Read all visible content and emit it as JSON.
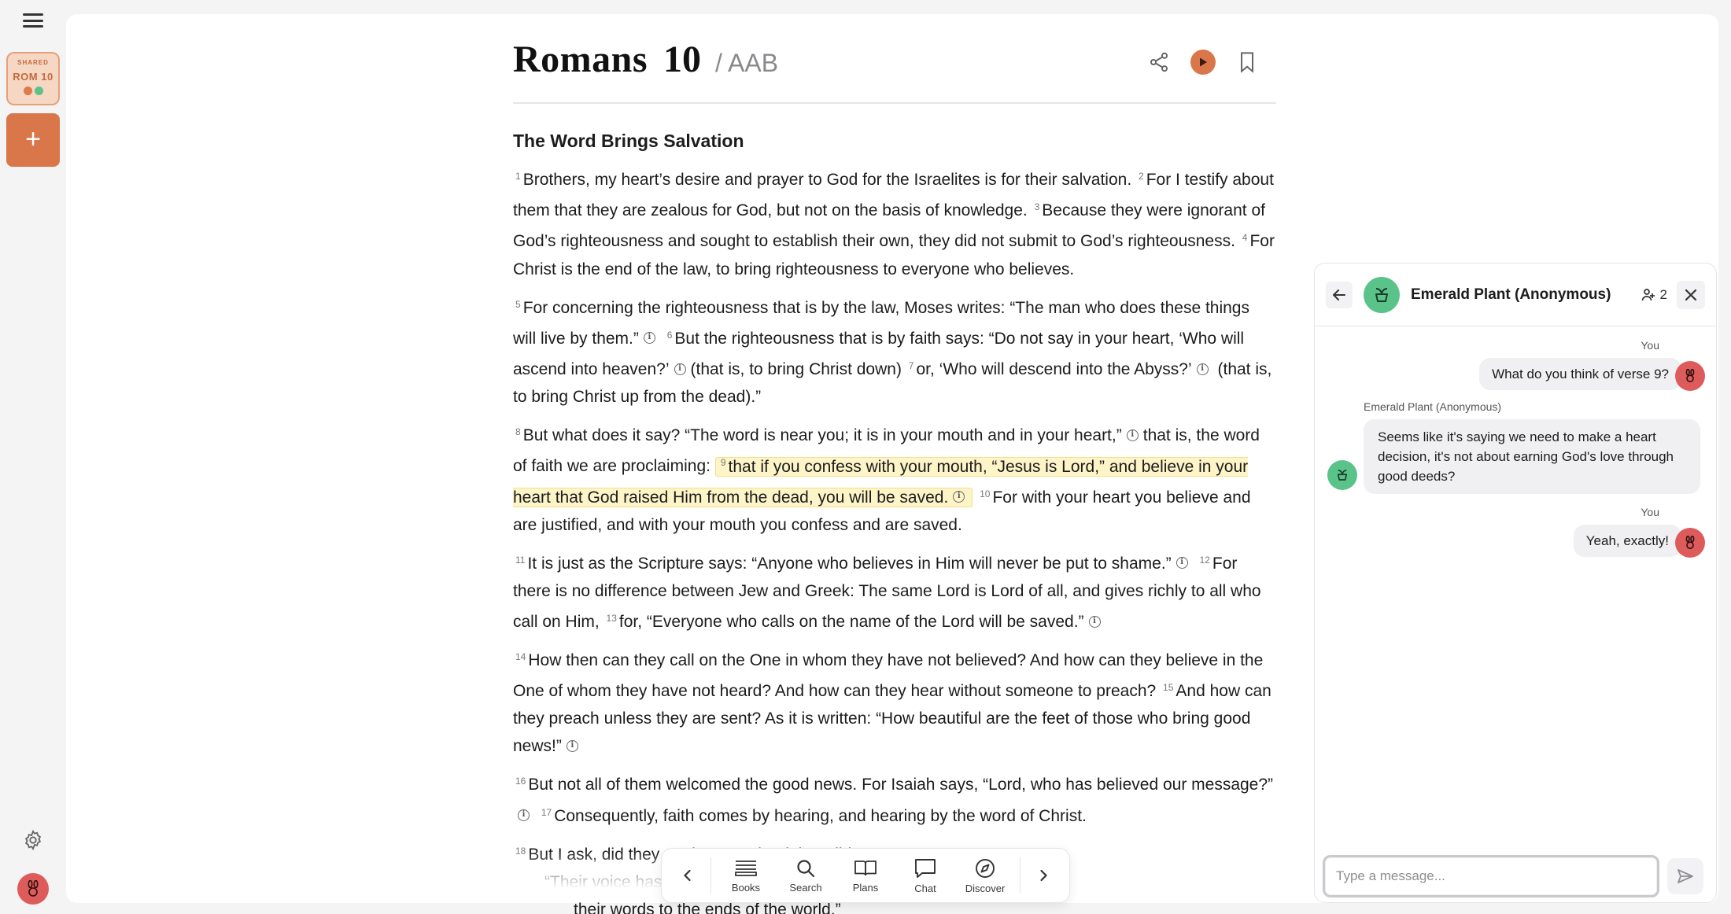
{
  "sidebar": {
    "shared_tag": "SHARED",
    "shared_label": "ROM 10",
    "shared_dot_colors": [
      "#e07a4a",
      "#59c38a"
    ],
    "add_icon": "+",
    "settings_icon": "gear-icon",
    "user_avatar_icon": "bunny-icon"
  },
  "reader": {
    "book": "Romans",
    "chapter": "10",
    "version": "/ AAB",
    "actions": [
      "share-icon",
      "play-icon",
      "bookmark-icon"
    ],
    "section_heading": "The Word Brings Salvation",
    "p1": {
      "v1": "1",
      "t1": "Brothers, my heart’s desire and prayer to God for the Israelites is for their salvation.",
      "v2": "2",
      "t2": "For I testify about them that they are zealous for God, but not on the basis of knowledge.",
      "v3": "3",
      "t3": "Because they were ignorant of God’s righteousness and sought to establish their own, they did not submit to God’s righteousness.",
      "v4": "4",
      "t4": "For Christ is the end of the law, to bring righteousness to everyone who believes."
    },
    "p2": {
      "v5": "5",
      "t5": "For concerning the righteousness that is by the law, Moses writes: “The man who does these things will live by them.”",
      "v6": "6",
      "t6a": "But the righteousness that is by faith says: “Do not say in your heart, ‘Who will ascend into heaven?’",
      "t6b": "(that is, to bring Christ down)",
      "v7": "7",
      "t7a": "or, ‘Who will descend into the Abyss?’",
      "t7b": "(that is, to bring Christ up from the dead).”"
    },
    "p3": {
      "v8": "8",
      "t8a": "But what does it say? “The word is near you; it is in your mouth and in your heart,”",
      "t8b": "that is, the word of faith we are proclaiming:",
      "v9": "9",
      "t9": "that if you confess with your mouth, “Jesus is Lord,” and believe in your heart that God raised Him from the dead, you will be saved.",
      "v10": "10",
      "t10": "For with your heart you believe and are justified, and with your mouth you confess and are saved."
    },
    "p4": {
      "v11": "11",
      "t11": "It is just as the Scripture says: “Anyone who believes in Him will never be put to shame.”",
      "v12": "12",
      "t12": "For there is no difference between Jew and Greek: The same Lord is Lord of all, and gives richly to all who call on Him,",
      "v13": "13",
      "t13": "for, “Everyone who calls on the name of the Lord will be saved.”"
    },
    "p5": {
      "v14": "14",
      "t14": "How then can they call on the One in whom they have not believed? And how can they believe in the One of whom they have not heard? And how can they hear without someone to preach?",
      "v15": "15",
      "t15": "And how can they preach unless they are sent? As it is written: “How beautiful are the feet of those who bring good news!”"
    },
    "p6": {
      "v16": "16",
      "t16": "But not all of them welcomed the good news. For Isaiah says, “Lord, who has believed our message?”",
      "v17": "17",
      "t17": "Consequently, faith comes by hearing, and hearing by the word of Christ."
    },
    "p7": {
      "v18": "18",
      "t18": "But I ask, did they not hear? Indeed they did:",
      "line1": "“Their voice has gone out into all the earth,",
      "line2": "their words to the ends of the world.”"
    },
    "note_glyph": "i"
  },
  "bottom_nav": {
    "prev_icon": "chevron-left-icon",
    "next_icon": "chevron-right-icon",
    "items": [
      {
        "label": "Books",
        "icon": "books-icon"
      },
      {
        "label": "Search",
        "icon": "search-icon"
      },
      {
        "label": "Plans",
        "icon": "book-open-icon"
      },
      {
        "label": "Chat",
        "icon": "chat-icon"
      },
      {
        "label": "Discover",
        "icon": "compass-icon"
      }
    ]
  },
  "chat": {
    "title": "Emerald Plant (Anonymous)",
    "member_count": "2",
    "messages": [
      {
        "sender": "You",
        "text": "What do you think of verse 9?"
      },
      {
        "sender": "Emerald Plant (Anonymous)",
        "text": "Seems like it's saying we need to make a heart decision, it's not about earning God's love through good deeds?"
      },
      {
        "sender": "You",
        "text": "Yeah, exactly!"
      }
    ],
    "input_placeholder": "Type a message...",
    "colors": {
      "self_avatar": "#de5b5b",
      "other_avatar": "#59c38a",
      "accent": "#d9774a"
    }
  }
}
